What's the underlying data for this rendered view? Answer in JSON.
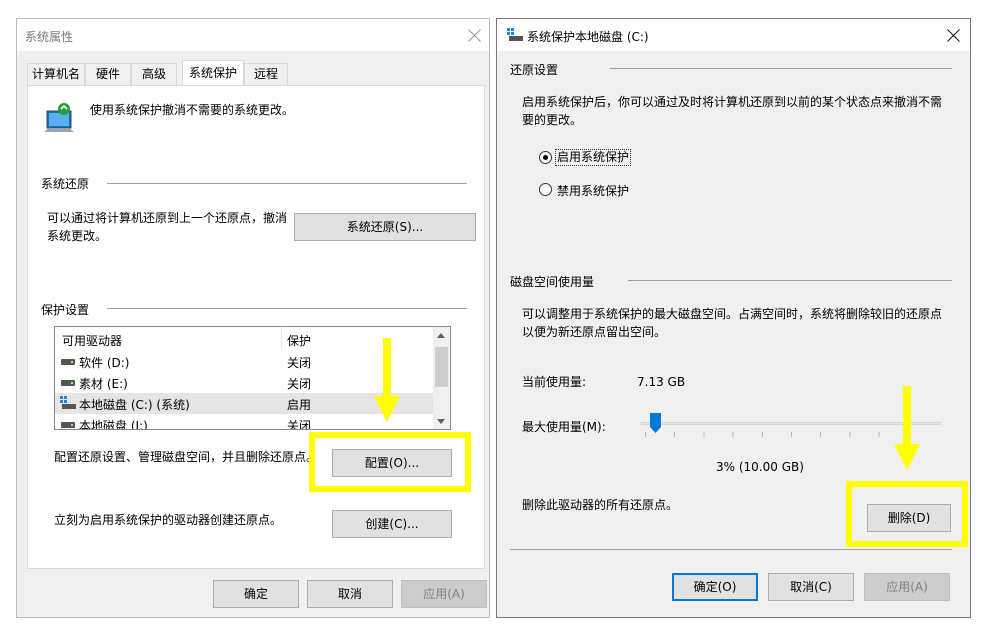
{
  "left_window": {
    "title": "系统属性",
    "tabs": [
      "计算机名",
      "硬件",
      "高级",
      "系统保护",
      "远程"
    ],
    "active_tab_index": 3,
    "intro_text": "使用系统保护撤消不需要的系统更改。",
    "restore_section": {
      "label": "系统还原",
      "description_line1": "可以通过将计算机还原到上一个还原点，撤消",
      "description_line2": "系统更改。",
      "button": "系统还原(S)..."
    },
    "protection_section": {
      "label": "保护设置",
      "columns": [
        "可用驱动器",
        "保护"
      ],
      "drives": [
        {
          "name": "软件 (D:)",
          "status": "关闭",
          "icon": "drive-icon"
        },
        {
          "name": "素材 (E:)",
          "status": "关闭",
          "icon": "drive-icon"
        },
        {
          "name": "本地磁盘 (C:) (系统)",
          "status": "启用",
          "icon": "system-drive-icon"
        },
        {
          "name": "本地磁盘 (J:)",
          "status": "关闭",
          "icon": "drive-icon"
        }
      ],
      "configure_text": "配置还原设置、管理磁盘空间，并且删除还原点。",
      "configure_button": "配置(O)...",
      "create_text": "立刻为启用系统保护的驱动器创建还原点。",
      "create_button": "创建(C)..."
    },
    "footer": {
      "ok": "确定",
      "cancel": "取消",
      "apply": "应用(A)"
    }
  },
  "right_window": {
    "title": "系统保护本地磁盘 (C:)",
    "restore_settings": {
      "label": "还原设置",
      "description_line1": "启用系统保护后，你可以通过及时将计算机还原到以前的某个状态点来撤消不需",
      "description_line2": "要的更改。",
      "options": [
        {
          "label": "启用系统保护",
          "checked": true
        },
        {
          "label": "禁用系统保护",
          "checked": false
        }
      ]
    },
    "disk_usage": {
      "label": "磁盘空间使用量",
      "description_line1": "可以调整用于系统保护的最大磁盘空间。占满空间时，系统将删除较旧的还原点",
      "description_line2": "以便为新还原点留出空间。",
      "current_label": "当前使用量:",
      "current_value": "7.13 GB",
      "max_label": "最大使用量(M):",
      "slider_percent": 3,
      "max_value_text": "3% (10.00 GB)",
      "delete_text": "删除此驱动器的所有还原点。",
      "delete_button": "删除(D)"
    },
    "footer": {
      "ok": "确定(O)",
      "cancel": "取消(C)",
      "apply": "应用(A)"
    }
  },
  "colors": {
    "highlight": "#ffff00",
    "default_button_border": "#0078d7",
    "window_bg": "#f0f0f0",
    "selected_row": "#e5e5e5"
  }
}
